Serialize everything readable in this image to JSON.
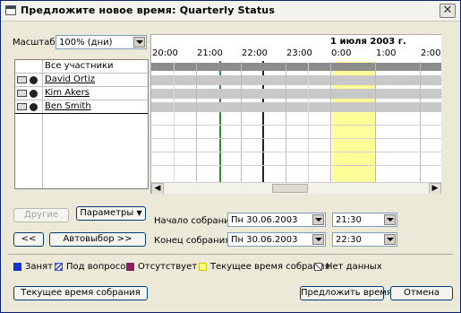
{
  "title": "Предложите новое время:  Quarterly Status",
  "scale": {
    "label": "Масштаб:",
    "value": "100% (дни)"
  },
  "grid": {
    "date": "1 июля 2003 г.",
    "times": [
      "20:00",
      "21:00",
      "22:00",
      "23:00",
      "0:00",
      "1:00",
      "2:00"
    ]
  },
  "attendees": {
    "header": "Все участники",
    "rows": [
      {
        "name": "David Ortiz"
      },
      {
        "name": "Kim Akers"
      },
      {
        "name": "Ben Smith"
      }
    ]
  },
  "buttons": {
    "others": "Другие",
    "options": "Параметры",
    "prev": "<<",
    "autopick": "Автовыбор >>",
    "current_time": "Текущее время собрания",
    "propose": "Предложить время",
    "cancel": "Отмена"
  },
  "meeting": {
    "start_label": "Начало собрания:",
    "start_date": "Пн 30.06.2003",
    "start_time": "21:30",
    "end_label": "Конец собрания:",
    "end_date": "Пн 30.06.2003",
    "end_time": "22:30"
  },
  "legend": [
    {
      "label": "Занят",
      "color": "#1a2fd0"
    },
    {
      "label": "Под вопросом",
      "color": "#4050e0"
    },
    {
      "label": "Отсутствует",
      "color": "#8b2060"
    },
    {
      "label": "Текущее время собрания",
      "color": "#ffff88"
    },
    {
      "label": "Нет данных",
      "color": "#ffffff"
    }
  ],
  "colors": {
    "busy_bar": "#a0a0a0",
    "current_meeting": "#ffff99",
    "green_line": "#2e8b2e"
  }
}
